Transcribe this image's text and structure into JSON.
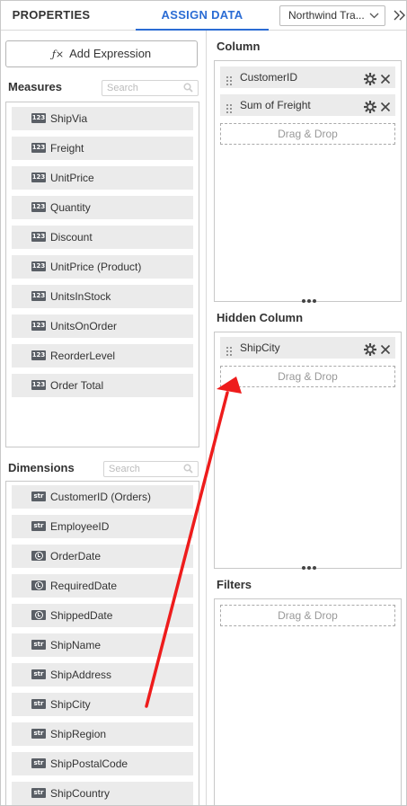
{
  "tabs": {
    "properties": "PROPERTIES",
    "assign_data": "ASSIGN DATA"
  },
  "datasource": {
    "selected": "Northwind Tra..."
  },
  "toolbar": {
    "expand_icon": "double-chevron-right-icon",
    "add_expression": "Add Expression",
    "fx_glyph": "ƒ×"
  },
  "measures": {
    "title": "Measures",
    "search_placeholder": "Search",
    "badge": "123",
    "items": [
      "ShipVia",
      "Freight",
      "UnitPrice",
      "Quantity",
      "Discount",
      "UnitPrice (Product)",
      "UnitsInStock",
      "UnitsOnOrder",
      "ReorderLevel",
      "Order Total"
    ]
  },
  "dimensions": {
    "title": "Dimensions",
    "search_placeholder": "Search",
    "items": [
      {
        "label": "CustomerID (Orders)",
        "badge": "str"
      },
      {
        "label": "EmployeeID",
        "badge": "str"
      },
      {
        "label": "OrderDate",
        "badge": "clock"
      },
      {
        "label": "RequiredDate",
        "badge": "clock"
      },
      {
        "label": "ShippedDate",
        "badge": "clock"
      },
      {
        "label": "ShipName",
        "badge": "str"
      },
      {
        "label": "ShipAddress",
        "badge": "str"
      },
      {
        "label": "ShipCity",
        "badge": "str"
      },
      {
        "label": "ShipRegion",
        "badge": "str"
      },
      {
        "label": "ShipPostalCode",
        "badge": "str"
      },
      {
        "label": "ShipCountry",
        "badge": "str"
      }
    ]
  },
  "column": {
    "title": "Column",
    "items": [
      "CustomerID",
      "Sum of Freight"
    ],
    "drop_hint": "Drag & Drop"
  },
  "hidden_column": {
    "title": "Hidden Column",
    "items": [
      "ShipCity"
    ],
    "drop_hint": "Drag & Drop"
  },
  "filters": {
    "title": "Filters",
    "drop_hint": "Drag & Drop"
  },
  "colors": {
    "accent": "#2b6cd4",
    "arrow": "#ee1c1c",
    "item_bg": "#ebebeb"
  }
}
